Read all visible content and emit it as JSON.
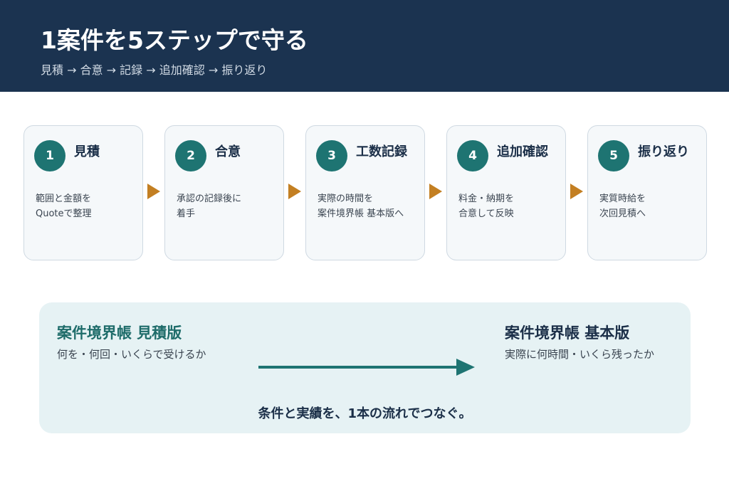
{
  "header": {
    "title": "1案件を5ステップで守る",
    "subtitle": "見積 → 合意 → 記録 → 追加確認 → 振り返り"
  },
  "steps": [
    {
      "number": "1",
      "title": "見積",
      "desc": [
        "範囲と金額を",
        "Quoteで整理"
      ]
    },
    {
      "number": "2",
      "title": "合意",
      "desc": [
        "承認の記録後に",
        "着手"
      ]
    },
    {
      "number": "3",
      "title": "工数記録",
      "desc": [
        "実際の時間を",
        "案件境界帳 基本版へ"
      ]
    },
    {
      "number": "4",
      "title": "追加確認",
      "desc": [
        "料金・納期を",
        "合意して反映"
      ]
    },
    {
      "number": "5",
      "title": "振り返り",
      "desc": [
        "実質時給を",
        "次回見積へ"
      ]
    }
  ],
  "panel": {
    "left_title": "案件境界帳 見積版",
    "left_desc": "何を・何回・いくらで受けるか",
    "right_title": "案件境界帳 基本版",
    "right_desc": "実際に何時間・いくら残ったか",
    "footer": "条件と実績を、1本の流れでつなぐ。"
  },
  "colors": {
    "header_bg": "#1b3350",
    "accent_teal": "#1e7472",
    "arrow_orange": "#c37f22",
    "card_bg": "#f5f8fa",
    "panel_bg": "#e6f2f4",
    "text_dark": "#1b2f48"
  }
}
